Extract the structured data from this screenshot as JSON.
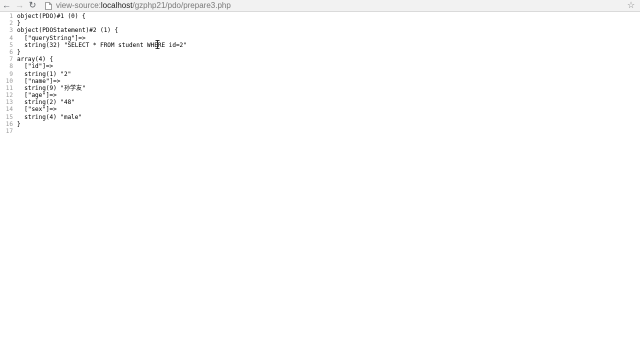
{
  "toolbar": {
    "back_icon": "arrow-left-icon",
    "forward_icon": "arrow-right-icon",
    "reload_icon": "reload-icon",
    "url_scheme": "view-source:",
    "url_host": "localhost",
    "url_path": "/gzphp21/pdo/prepare3.php",
    "bookmark_icon": "star-icon"
  },
  "source": {
    "lines": [
      {
        "n": "1",
        "text": "object(PDO)#1 (0) {"
      },
      {
        "n": "2",
        "text": "}"
      },
      {
        "n": "3",
        "text": "object(PDOStatement)#2 (1) {"
      },
      {
        "n": "4",
        "text": "  [\"queryString\"]=>"
      },
      {
        "n": "5",
        "text": "  string(32) \"SELECT * FROM student WHERE id=2\""
      },
      {
        "n": "6",
        "text": "}"
      },
      {
        "n": "7",
        "text": "array(4) {"
      },
      {
        "n": "8",
        "text": "  [\"id\"]=>"
      },
      {
        "n": "9",
        "text": "  string(1) \"2\""
      },
      {
        "n": "10",
        "text": "  [\"name\"]=>"
      },
      {
        "n": "11",
        "text": "  string(9) \"孙学友\""
      },
      {
        "n": "12",
        "text": "  [\"age\"]=>"
      },
      {
        "n": "13",
        "text": "  string(2) \"48\""
      },
      {
        "n": "14",
        "text": "  [\"sex\"]=>"
      },
      {
        "n": "15",
        "text": "  string(4) \"male\""
      },
      {
        "n": "16",
        "text": "}"
      },
      {
        "n": "17",
        "text": ""
      }
    ]
  }
}
